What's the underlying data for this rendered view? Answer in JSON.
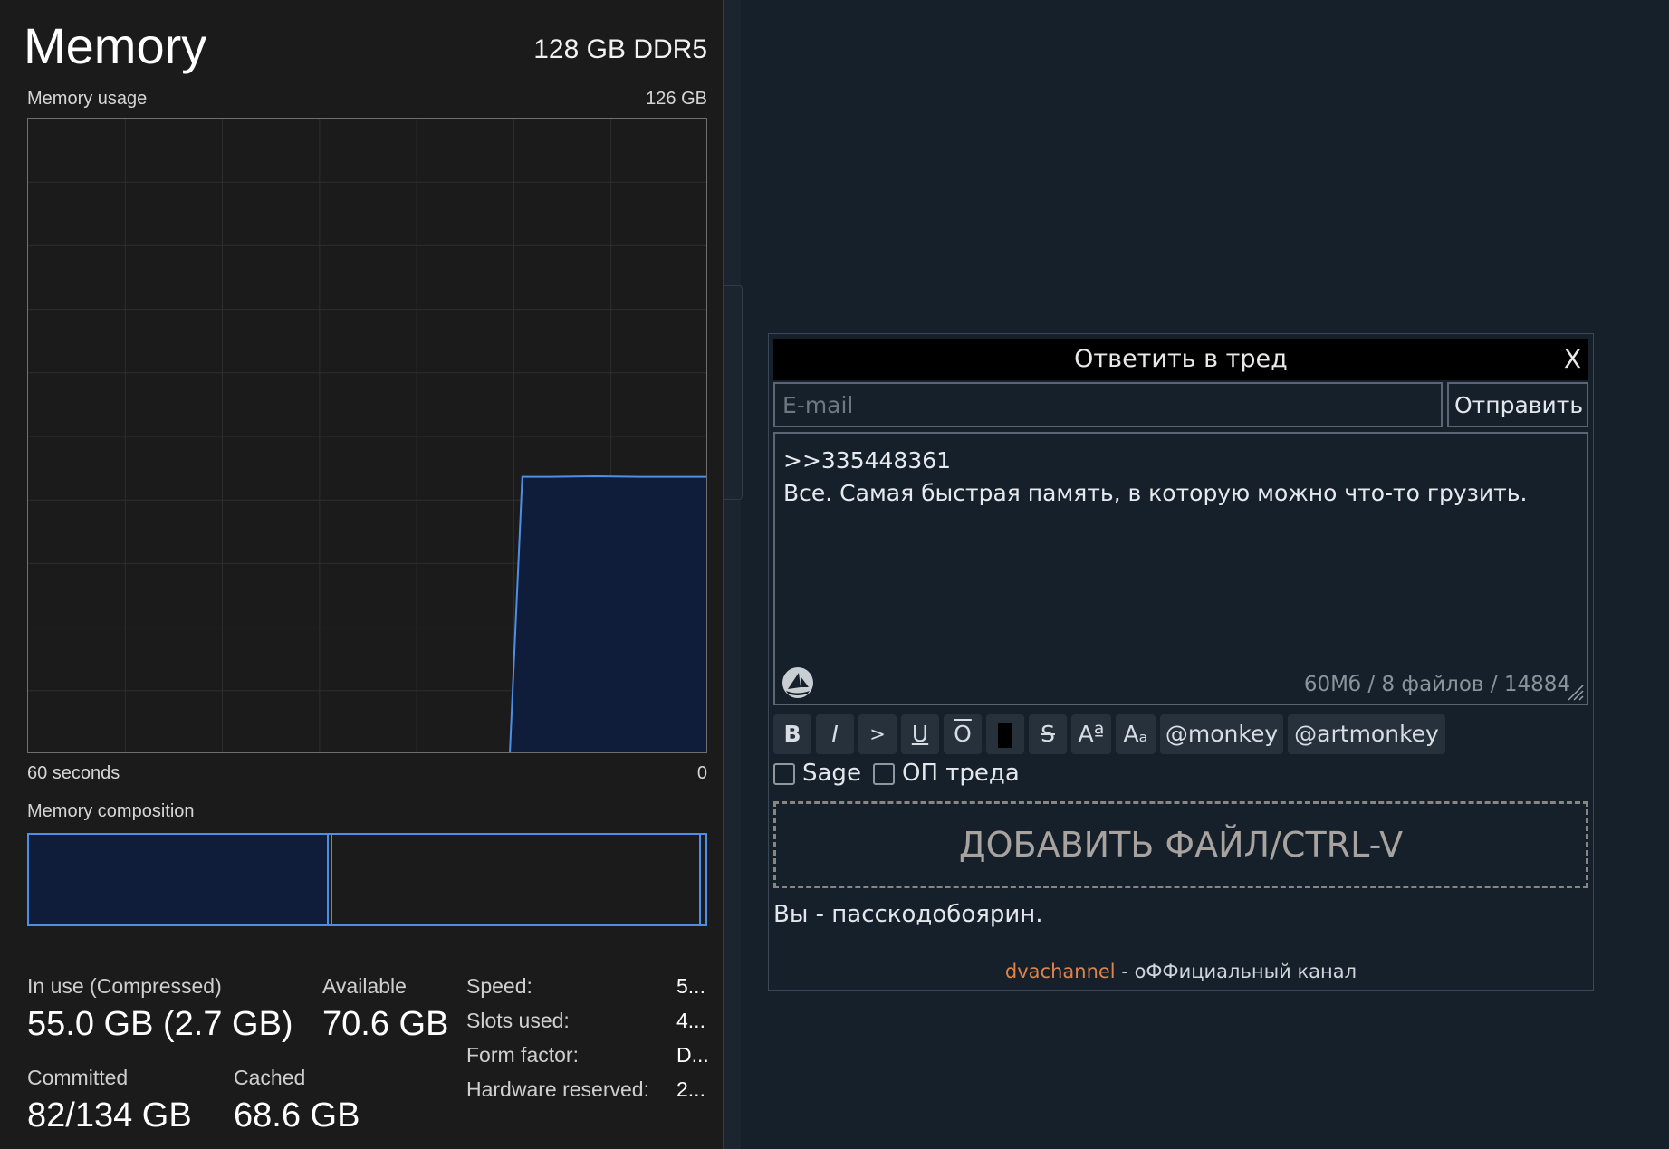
{
  "task_manager": {
    "title": "Memory",
    "spec": "128 GB DDR5",
    "usage_label": "Memory usage",
    "usage_max": "126 GB",
    "axis_left": "60 seconds",
    "axis_right": "0",
    "composition_label": "Memory composition",
    "composition": {
      "in_use_fraction": 0.44,
      "modified_fraction": 0.005,
      "standby_fraction": 0.545
    },
    "stats": {
      "in_use_label": "In use (Compressed)",
      "in_use_value": "55.0 GB (2.7 GB)",
      "available_label": "Available",
      "available_value": "70.6 GB",
      "committed_label": "Committed",
      "committed_value": "82/134 GB",
      "cached_label": "Cached",
      "cached_value": "68.6 GB"
    },
    "properties": [
      {
        "label": "Speed:",
        "value": "5..."
      },
      {
        "label": "Slots used:",
        "value": "4..."
      },
      {
        "label": "Form factor:",
        "value": "D..."
      },
      {
        "label": "Hardware reserved:",
        "value": "2..."
      }
    ],
    "colors": {
      "line": "#4e8fe6",
      "fill": "#0f1d3a",
      "grid": "#2e2e2e"
    }
  },
  "chart_data": {
    "type": "area",
    "title": "Memory usage",
    "xlabel": "",
    "ylabel": "",
    "xlim": [
      60,
      0
    ],
    "ylim": [
      0,
      126
    ],
    "x": [
      60,
      17.5,
      16.4,
      14,
      10,
      6,
      0
    ],
    "values": [
      0,
      0,
      55.0,
      55.0,
      55.1,
      55.0,
      55.0
    ],
    "grid": true
  },
  "reply_form": {
    "title": "Ответить в тред",
    "close_label": "X",
    "email_placeholder": "E-mail",
    "email_value": "",
    "submit_label": "Отправить",
    "message_lines": [
      ">>335448361",
      "Все. Самая быстрая память, в которую можно что-то грузить."
    ],
    "limits": "60Мб / 8 файлов / 14884",
    "toolbar": [
      {
        "label": "B",
        "name": "bold-button"
      },
      {
        "label": "I",
        "name": "italic-button"
      },
      {
        "label": ">",
        "name": "quote-button"
      },
      {
        "label": "U",
        "name": "underline-button"
      },
      {
        "label": "O",
        "name": "overline-button"
      },
      {
        "label": "",
        "name": "spoiler-button"
      },
      {
        "label": "S",
        "name": "strikethrough-button"
      },
      {
        "label": "Aª",
        "name": "superscript-button"
      },
      {
        "label": "Aₐ",
        "name": "subscript-button"
      },
      {
        "label": "@monkey",
        "name": "monkey-button"
      },
      {
        "label": "@artmonkey",
        "name": "artmonkey-button"
      }
    ],
    "sage_label": "Sage",
    "op_label": "ОП треда",
    "dropzone_label": "ДОБАВИТЬ ФАЙЛ/CTRL-V",
    "pass_text": "Вы - пасскодобоярин.",
    "footer_link": "dvachannel",
    "footer_text": " - оФФициальный канал",
    "colors": {
      "link": "#e0834a",
      "background": "#16202b",
      "header": "#000000"
    }
  }
}
